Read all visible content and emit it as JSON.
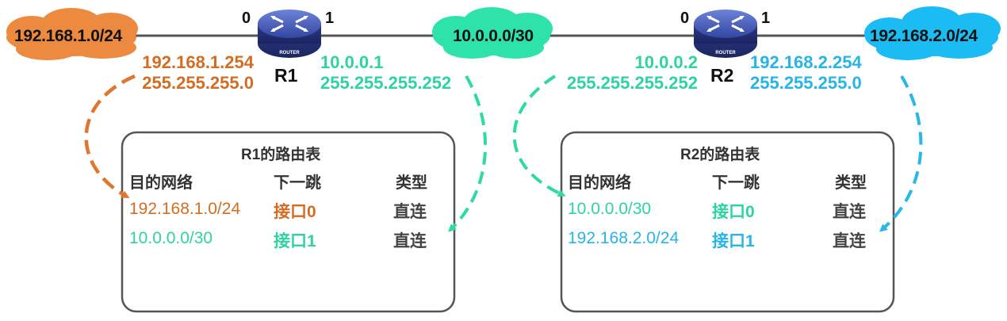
{
  "colors": {
    "orange": "#e8863a",
    "green": "#2ee0a8",
    "blue": "#19b8f0",
    "router": "#3a4fa8"
  },
  "clouds": {
    "left": "192.168.1.0/24",
    "middle": "10.0.0.0/30",
    "right": "192.168.2.0/24"
  },
  "routers": [
    {
      "name": "R1",
      "icon_text": "ROUTER",
      "port_left": "0",
      "port_right": "1",
      "left_ip": "192.168.1.254",
      "left_mask": "255.255.255.0",
      "right_ip": "10.0.0.1",
      "right_mask": "255.255.255.252"
    },
    {
      "name": "R2",
      "icon_text": "ROUTER",
      "port_left": "0",
      "port_right": "1",
      "left_ip": "10.0.0.2",
      "left_mask": "255.255.255.252",
      "right_ip": "192.168.2.254",
      "right_mask": "255.255.255.0"
    }
  ],
  "tables": [
    {
      "title": "R1的路由表",
      "headers": [
        "目的网络",
        "下一跳",
        "类型"
      ],
      "rows": [
        {
          "network": "192.168.1.0/24",
          "next_hop": "接口0",
          "type": "直连"
        },
        {
          "network": "10.0.0.0/30",
          "next_hop": "接口1",
          "type": "直连"
        }
      ]
    },
    {
      "title": "R2的路由表",
      "headers": [
        "目的网络",
        "下一跳",
        "类型"
      ],
      "rows": [
        {
          "network": "10.0.0.0/30",
          "next_hop": "接口0",
          "type": "直连"
        },
        {
          "network": "192.168.2.0/24",
          "next_hop": "接口1",
          "type": "直连"
        }
      ]
    }
  ]
}
